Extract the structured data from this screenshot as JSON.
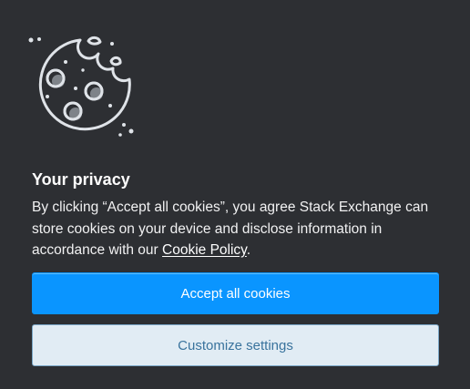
{
  "privacy": {
    "title": "Your privacy",
    "body_prefix": "By clicking “Accept all cookies”, you agree Stack Exchange can store cookies on your device and disclose information in accordance with our ",
    "policy_link": "Cookie Policy",
    "body_suffix": "."
  },
  "buttons": {
    "accept": "Accept all cookies",
    "customize": "Customize settings"
  },
  "icons": {
    "illustration": "cookie-icon"
  },
  "colors": {
    "background": "#2d2f33",
    "primary": "#0a95ff",
    "secondary_bg": "#e1ecf4",
    "secondary_text": "#39739d"
  }
}
